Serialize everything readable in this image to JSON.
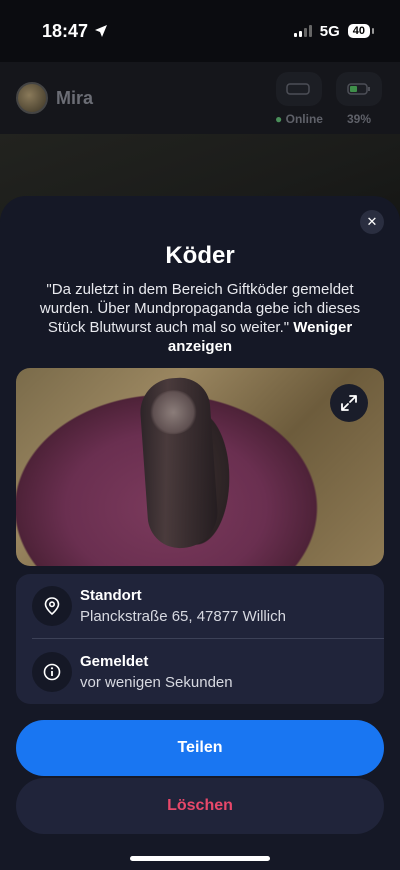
{
  "status_bar": {
    "time": "18:47",
    "network": "5G",
    "battery": "40"
  },
  "background": {
    "profile_name": "Mira",
    "stats": [
      {
        "label": "Online",
        "icon": "device-icon"
      },
      {
        "label": "39%",
        "icon": "battery-icon"
      }
    ]
  },
  "sheet": {
    "title": "Köder",
    "description": "\"Da zuletzt in dem Bereich Giftköder gemeldet wurden. Über Mundpropaganda gebe ich dieses Stück Blutwurst auch mal so weiter.\"",
    "show_less": "Weniger anzeigen",
    "info": [
      {
        "label": "Standort",
        "value": "Planckstraße 65, 47877 Willich",
        "icon": "location-pin-icon"
      },
      {
        "label": "Gemeldet",
        "value": "vor wenigen Sekunden",
        "icon": "info-icon"
      }
    ],
    "share_label": "Teilen",
    "delete_label": "Löschen"
  },
  "colors": {
    "sheet_bg": "#151826",
    "card_bg": "#20243a",
    "primary": "#1976f2",
    "danger": "#e8486a"
  }
}
